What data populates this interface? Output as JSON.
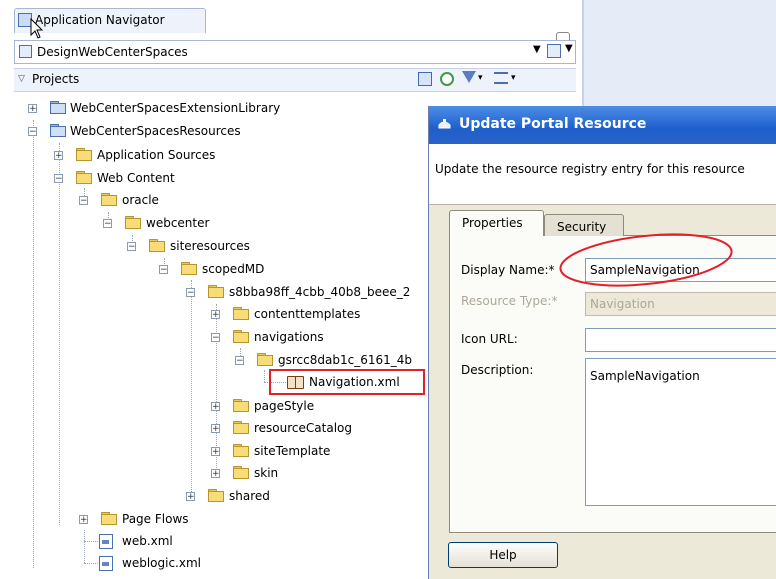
{
  "navigator": {
    "tab_title": "Application Navigator",
    "application_name": "DesignWebCenterSpaces",
    "projects_label": "Projects"
  },
  "tree": [
    {
      "label": "WebCenterSpacesExtensionLibrary",
      "expander": "+",
      "icon": "project"
    },
    {
      "label": "WebCenterSpacesResources",
      "expander": "-",
      "icon": "project"
    },
    {
      "label": "Application Sources",
      "expander": "+",
      "icon": "folder"
    },
    {
      "label": "Web Content",
      "expander": "-",
      "icon": "folder"
    },
    {
      "label": "oracle",
      "expander": "-",
      "icon": "folder"
    },
    {
      "label": "webcenter",
      "expander": "-",
      "icon": "folder"
    },
    {
      "label": "siteresources",
      "expander": "-",
      "icon": "folder"
    },
    {
      "label": "scopedMD",
      "expander": "-",
      "icon": "folder"
    },
    {
      "label": "s8bba98ff_4cbb_40b8_beee_2",
      "expander": "-",
      "icon": "folder"
    },
    {
      "label": "contenttemplates",
      "expander": "+",
      "icon": "folder"
    },
    {
      "label": "navigations",
      "expander": "-",
      "icon": "folder"
    },
    {
      "label": "gsrcc8dab1c_6161_4b",
      "expander": "-",
      "icon": "folder"
    },
    {
      "label": "Navigation.xml",
      "expander": "",
      "icon": "book"
    },
    {
      "label": "pageStyle",
      "expander": "+",
      "icon": "folder"
    },
    {
      "label": "resourceCatalog",
      "expander": "+",
      "icon": "folder"
    },
    {
      "label": "siteTemplate",
      "expander": "+",
      "icon": "folder"
    },
    {
      "label": "skin",
      "expander": "+",
      "icon": "folder"
    },
    {
      "label": "shared",
      "expander": "+",
      "icon": "folder"
    },
    {
      "label": "Page Flows",
      "expander": "+",
      "icon": "folder"
    },
    {
      "label": "web.xml",
      "expander": "",
      "icon": "xmlfile"
    },
    {
      "label": "weblogic.xml",
      "expander": "",
      "icon": "xmlfile"
    }
  ],
  "dialog": {
    "title": "Update Portal Resource",
    "description": "Update the resource registry entry for this resource",
    "tabs": [
      "Properties",
      "Security"
    ],
    "fields": {
      "display_name_label": "Display Name:*",
      "display_name_value": "SampleNavigation",
      "resource_type_label": "Resource Type:*",
      "resource_type_value": "Navigation",
      "icon_url_label": "Icon URL:",
      "icon_url_value": "",
      "description_label": "Description:",
      "description_value": "SampleNavigation"
    },
    "help_label": "Help"
  },
  "colors": {
    "highlight_red": "#e3202a",
    "titlebar_blue": "#2a63c7"
  }
}
